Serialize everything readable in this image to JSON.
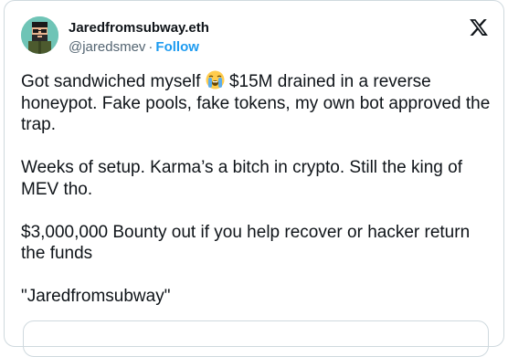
{
  "author": {
    "display_name": "Jaredfromsubway.eth",
    "handle": "@jaredsmev",
    "separator": "·",
    "follow_label": "Follow",
    "avatar_icon": "pixel-art-avatar-icon"
  },
  "platform_icon": "x-logo-icon",
  "tweet": {
    "line1_before_emoji": "Got sandwiched myself ",
    "emoji_icon": "loudly-crying-face-emoji",
    "line1_after_emoji": " $15M drained in a reverse honeypot. Fake pools, fake tokens, my own bot approved the trap.",
    "paragraph2": "Weeks of setup. Karma’s a bitch in crypto. Still the king of MEV tho.",
    "paragraph3": "$3,000,000 Bounty out if you help recover or hacker return the funds",
    "paragraph4": "\"Jaredfromsubway\""
  },
  "colors": {
    "accent": "#1d9bf0",
    "text": "#0f1419",
    "muted": "#536471",
    "avatar_bg": "#6fc4b6"
  }
}
